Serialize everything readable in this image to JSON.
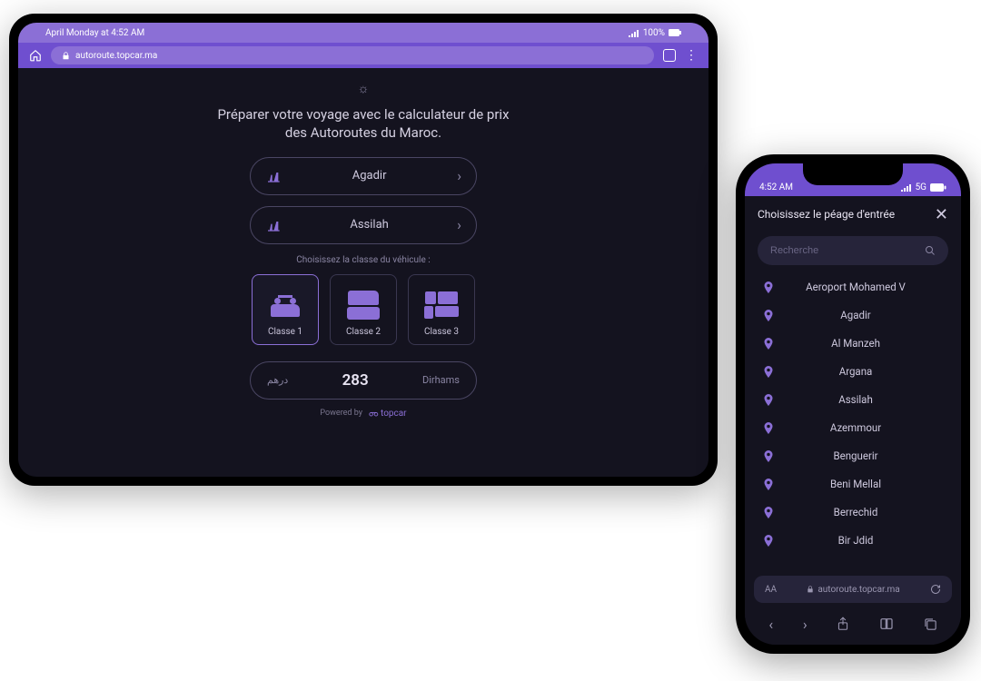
{
  "tablet": {
    "status": {
      "left": "April Monday at 4:52 AM",
      "battery": "100%"
    },
    "url": "autoroute.topcar.ma",
    "headline": "Préparer votre voyage avec le calculateur de prix des Autoroutes du Maroc.",
    "entry_toll": "Agadir",
    "exit_toll": "Assilah",
    "class_label": "Choisissez la classe du véhicule :",
    "classes": [
      "Classe 1",
      "Classe 2",
      "Classe 3"
    ],
    "result": {
      "ar": "درهم",
      "value": "283",
      "currency": "Dirhams"
    },
    "powered_prefix": "Powered by",
    "powered_brand": "topcar"
  },
  "phone": {
    "status": {
      "time": "4:52 AM",
      "net": "5G"
    },
    "header": "Choisissez le péage d'entrée",
    "search_placeholder": "Recherche",
    "tolls": [
      "Aeroport Mohamed V",
      "Agadir",
      "Al Manzeh",
      "Argana",
      "Assilah",
      "Azemmour",
      "Benguerir",
      "Beni Mellal",
      "Berrechid",
      "Bir Jdid"
    ],
    "url": "autoroute.topcar.ma",
    "url_prefix": "AA"
  }
}
